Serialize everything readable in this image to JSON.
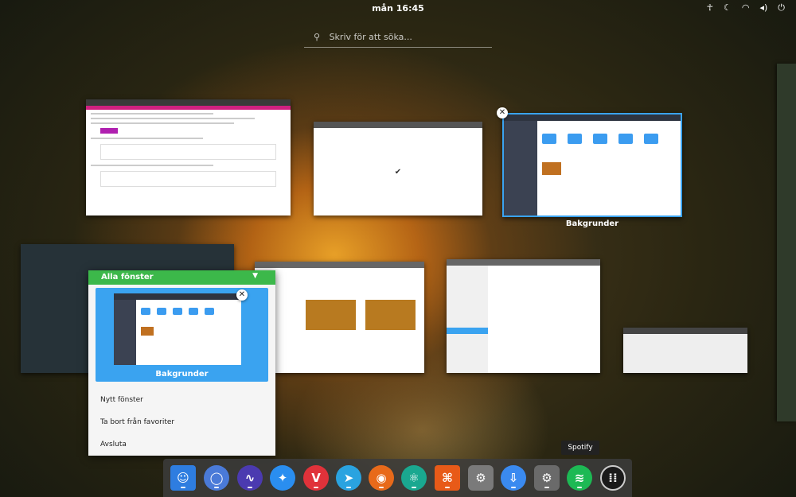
{
  "topbar": {
    "clock": "mån 16:45",
    "icons": [
      "accessibility-icon",
      "night-mode-icon",
      "wifi-icon",
      "volume-icon",
      "power-icon"
    ]
  },
  "search": {
    "placeholder": "Skriv för att söka..."
  },
  "windows": {
    "files_label": "Bakgrunder"
  },
  "context_menu": {
    "header": "Alla fönster",
    "preview_label": "Bakgrunder",
    "items": [
      "Nytt fönster",
      "Ta bort från favoriter",
      "Avsluta"
    ]
  },
  "dock": {
    "tooltip": "Spotify",
    "apps": [
      "Finder",
      "Chromium",
      "Audio",
      "Safari",
      "Vivaldi",
      "Telegram",
      "Firefox",
      "Atom",
      "GIMP",
      "System Settings",
      "Downloader",
      "Settings",
      "Spotify",
      "Applications"
    ]
  },
  "colors": {
    "accent": "#3aa3f0",
    "menu_header": "#3cb84a"
  }
}
